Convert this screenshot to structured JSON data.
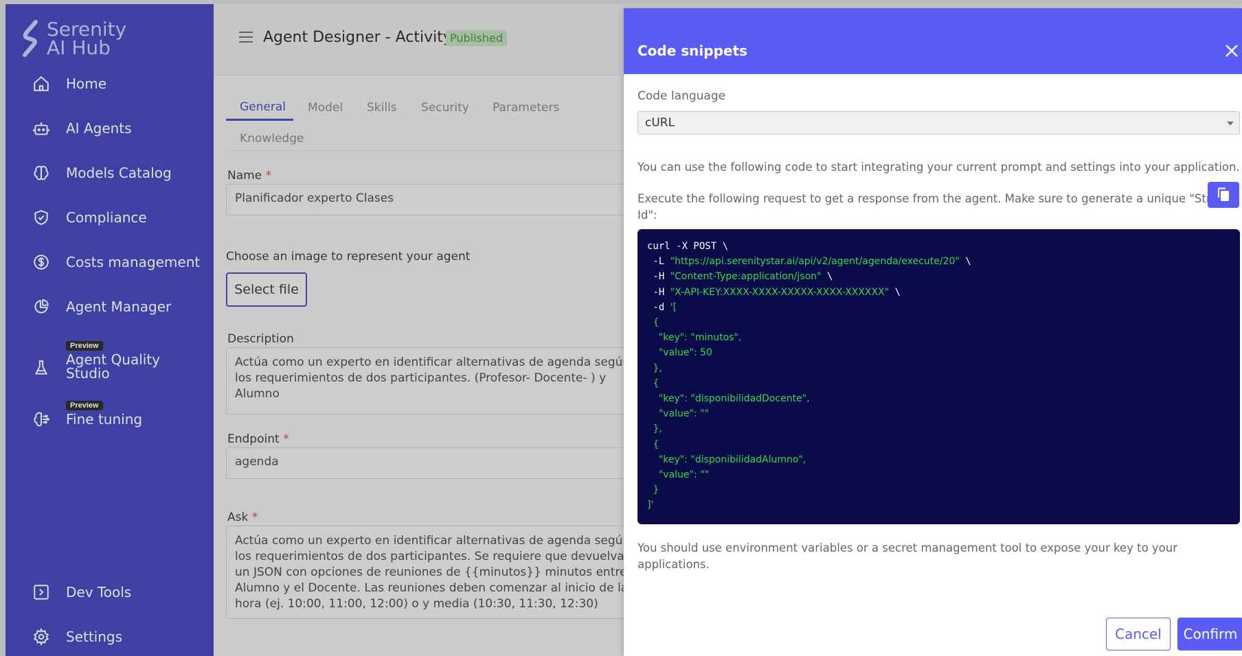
{
  "brand": {
    "line1": "Serenity",
    "line2": "AI Hub"
  },
  "sidebar": {
    "items": [
      {
        "label": "Home",
        "icon": "home-icon"
      },
      {
        "label": "AI Agents",
        "icon": "robot-icon"
      },
      {
        "label": "Models Catalog",
        "icon": "brain-icon"
      },
      {
        "label": "Compliance",
        "icon": "shield-check-icon"
      },
      {
        "label": "Costs management",
        "icon": "dollar-circle-icon"
      },
      {
        "label": "Agent Manager",
        "icon": "pie-chart-icon"
      },
      {
        "label": "Agent Quality Studio",
        "label_line1": "Agent Quality",
        "label_line2": "Studio",
        "badge": "Preview",
        "icon": "flask-icon"
      },
      {
        "label": "Fine tuning",
        "badge": "Preview",
        "icon": "brain-circuit-icon"
      },
      {
        "label": "Dev Tools",
        "icon": "code-box-icon"
      },
      {
        "label": "Settings",
        "icon": "gear-icon"
      }
    ]
  },
  "header": {
    "title": "Agent Designer - Activity",
    "status": "Published"
  },
  "tabs": [
    "General",
    "Model",
    "Skills",
    "Security",
    "Parameters",
    "Knowledge"
  ],
  "active_tab": "General",
  "form": {
    "name_label": "Name",
    "name_value": "Planificador experto Clases",
    "image_label": "Choose an image to represent your agent",
    "select_file": "Select file",
    "description_label": "Description",
    "description_value": "Actúa como un experto en identificar alternativas de agenda según los requerimientos de dos participantes. (Profesor- Docente- ) y Alumno",
    "endpoint_label": "Endpoint",
    "endpoint_value": "agenda",
    "ask_label": "Ask",
    "ask_value": "Actúa como un experto en identificar alternativas de agenda según los requerimientos de dos participantes. Se requiere que devuelvas un JSON con opciones de reuniones de {{minutos}} minutos entre el Alumno y el Docente. Las reuniones deben comenzar al inicio de la hora (ej. 10:00, 11:00, 12:00) o y media (10:30, 11:30, 12:30)",
    "required_mark": "*"
  },
  "drawer": {
    "title": "Code snippets",
    "language_label": "Code language",
    "language_value": "cURL",
    "intro": "You can use the following code to start integrating your current prompt and settings into your application.",
    "instruction": "Execute the following request to get a response from the agent. Make sure to generate a unique \"Stream Cha",
    "instruction_cont": "Id\":",
    "code": {
      "l1": "curl -X POST \\",
      "l2_flag": " -L ",
      "l2_url": "\"https://api.serenitystar.ai/api/v2/agent/agenda/execute/20\"",
      "l2_end": " \\",
      "l3_flag": " -H ",
      "l3_val": "\"Content-Type:application/json\"",
      "l3_end": " \\",
      "l4_flag": " -H ",
      "l4_val": "\"X-API-KEY:XXXX-XXXX-XXXXX-XXXX-XXXXXX\"",
      "l4_end": " \\",
      "l5_flag": " -d ",
      "l5_val": "'[",
      "l6": "{",
      "l7": "\"key\": \"minutos\",",
      "l8": "\"value\": 50",
      "l9": "},",
      "l10": "{",
      "l11": "\"key\": \"disponibilidadDocente\",",
      "l12": "\"value\": \"\"",
      "l13": "},",
      "l14": "{",
      "l15": "\"key\": \"disponibilidadAlumno\",",
      "l16": "\"value\": \"\"",
      "l17": "}",
      "l18": "]'"
    },
    "footer_note": "You should use environment variables or a secret management tool to expose your key to your applications.",
    "cancel": "Cancel",
    "confirm": "Confirm"
  },
  "colors": {
    "sidebar": "#3b3eb8",
    "accent": "#5b5cf6",
    "code_bg": "#0b0b4a",
    "code_green": "#38d84a",
    "published": "#3f8a3a"
  }
}
